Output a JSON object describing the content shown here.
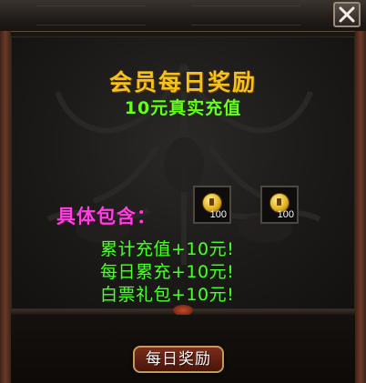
{
  "window": {
    "close_icon": "close-x-icon"
  },
  "reward": {
    "title": "会员每日奖励",
    "subtitle": "10元真实充值",
    "includes_label": "具体包含：",
    "items": [
      {
        "icon": "gold-coin-icon",
        "quantity": "100"
      },
      {
        "icon": "gold-coin-icon",
        "quantity": "100"
      }
    ],
    "benefits": [
      "累计充值+10元!",
      "每日累充+10元!",
      "白票礼包+10元!"
    ],
    "claim_button_label": "每日奖励"
  },
  "colors": {
    "title": "#f3c21d",
    "subtitle": "#66ff1a",
    "includes_label": "#ff3fe0",
    "benefit_text": "#4dff2a"
  }
}
